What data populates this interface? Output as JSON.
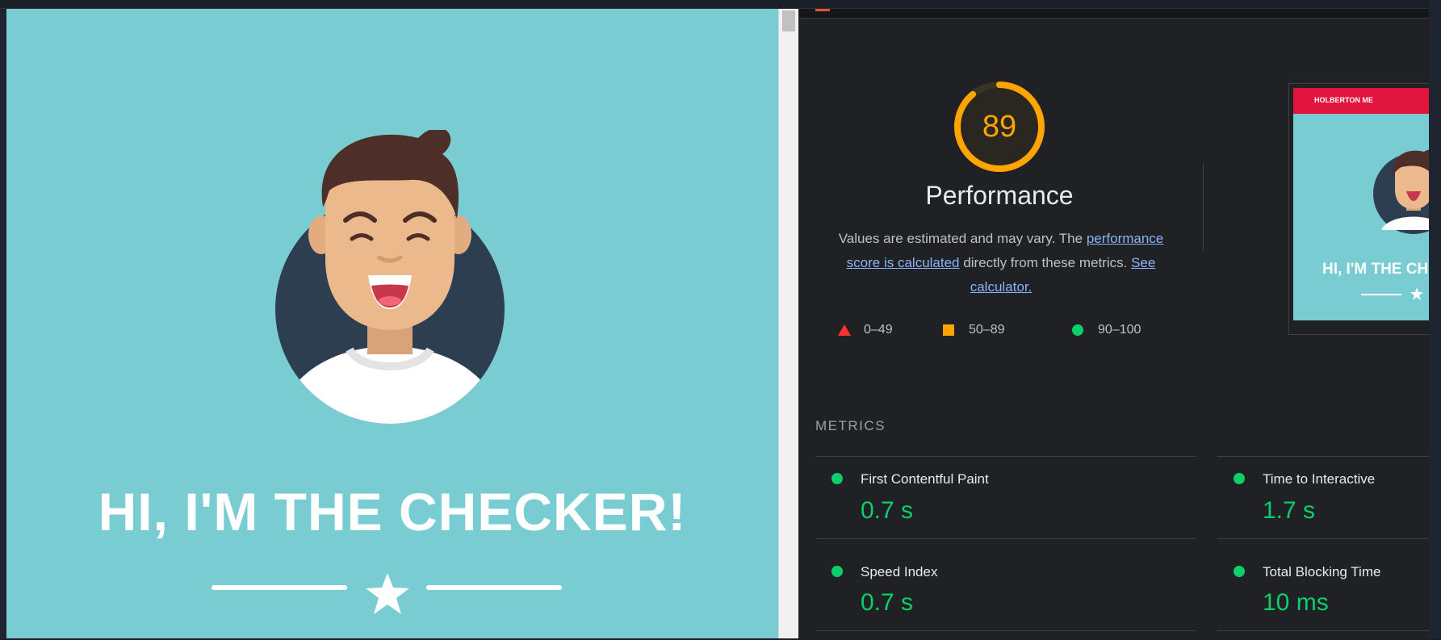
{
  "preview": {
    "hero_title": "HI, I'M THE CHECKER!",
    "icons": [
      "avatar-illustration",
      "star-icon"
    ],
    "colors": {
      "background": "#79cdd2",
      "avatar_circle": "#2d3e50",
      "hair": "#4e2e28",
      "skin": "#ebb98c"
    }
  },
  "lighthouse": {
    "score": "89",
    "category_title": "Performance",
    "description": {
      "prefix": "Values are estimated and may vary. The ",
      "link_score": "performance score is calculated",
      "middle": " directly from these metrics. ",
      "link_calculator": "See calculator."
    },
    "legend": [
      {
        "shape": "triangle",
        "color": "#ff3333",
        "label": "0–49"
      },
      {
        "shape": "square",
        "color": "#ffa400",
        "label": "50–89"
      },
      {
        "shape": "circle",
        "color": "#0cce6b",
        "label": "90–100"
      }
    ],
    "screenshot_thumb": {
      "brand": "HOLBERTON ME",
      "title": "HI, I'M THE CH"
    },
    "metrics_heading": "METRICS",
    "metrics": [
      {
        "label": "First Contentful Paint",
        "value": "0.7 s",
        "status": "pass"
      },
      {
        "label": "Time to Interactive",
        "value": "1.7 s",
        "status": "pass"
      },
      {
        "label": "Speed Index",
        "value": "0.7 s",
        "status": "pass"
      },
      {
        "label": "Total Blocking Time",
        "value": "10 ms",
        "status": "pass"
      }
    ],
    "colors": {
      "panel_bg": "#202124",
      "score_orange": "#ffa400",
      "pass_green": "#0cce6b",
      "link_blue": "#8ab4f8"
    }
  }
}
